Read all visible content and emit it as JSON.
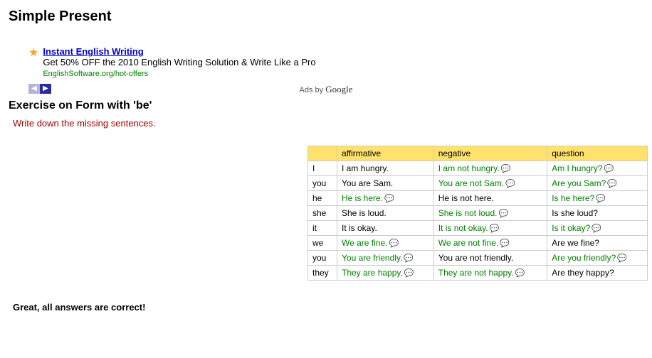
{
  "page_title": "Simple Present",
  "ad": {
    "title": "Instant English Writing",
    "desc": "Get 50% OFF the 2010 English Writing Solution & Write Like a Pro",
    "url": "EnglishSoftware.org/hot-offers",
    "prev_glyph": "◀",
    "next_glyph": "▶",
    "adsby_prefix": "Ads by ",
    "adsby_brand": "Google"
  },
  "exercise_heading": "Exercise on Form with 'be'",
  "instruction": "Write down the missing sentences.",
  "headers": {
    "affirmative": "affirmative",
    "negative": "negative",
    "question": "question"
  },
  "rows": [
    {
      "pron": "I",
      "aff": {
        "text": "I am hungry.",
        "ans": false,
        "note": false
      },
      "neg": {
        "text": "I am not hungry.",
        "ans": true,
        "note": true
      },
      "q": {
        "text": "Am I hungry?",
        "ans": true,
        "note": true
      }
    },
    {
      "pron": "you",
      "aff": {
        "text": "You are Sam.",
        "ans": false,
        "note": false
      },
      "neg": {
        "text": "You are not Sam.",
        "ans": true,
        "note": true
      },
      "q": {
        "text": "Are you Sam?",
        "ans": true,
        "note": true
      }
    },
    {
      "pron": "he",
      "aff": {
        "text": "He is here.",
        "ans": true,
        "note": true
      },
      "neg": {
        "text": "He is not here.",
        "ans": false,
        "note": false
      },
      "q": {
        "text": "Is he here?",
        "ans": true,
        "note": true
      }
    },
    {
      "pron": "she",
      "aff": {
        "text": "She is loud.",
        "ans": false,
        "note": false
      },
      "neg": {
        "text": "She is not loud.",
        "ans": true,
        "note": true
      },
      "q": {
        "text": "Is she loud?",
        "ans": false,
        "note": false
      }
    },
    {
      "pron": "it",
      "aff": {
        "text": "It is okay.",
        "ans": false,
        "note": false
      },
      "neg": {
        "text": "It is not okay.",
        "ans": true,
        "note": true
      },
      "q": {
        "text": "Is it okay?",
        "ans": true,
        "note": true
      }
    },
    {
      "pron": "we",
      "aff": {
        "text": "We are fine.",
        "ans": true,
        "note": true
      },
      "neg": {
        "text": "We are not fine.",
        "ans": true,
        "note": true
      },
      "q": {
        "text": "Are we fine?",
        "ans": false,
        "note": false
      }
    },
    {
      "pron": "you",
      "aff": {
        "text": "You are friendly.",
        "ans": true,
        "note": true
      },
      "neg": {
        "text": "You are not friendly.",
        "ans": false,
        "note": false
      },
      "q": {
        "text": "Are you friendly?",
        "ans": true,
        "note": true
      }
    },
    {
      "pron": "they",
      "aff": {
        "text": "They are happy.",
        "ans": true,
        "note": true
      },
      "neg": {
        "text": "They are not happy.",
        "ans": true,
        "note": true
      },
      "q": {
        "text": "Are they happy?",
        "ans": false,
        "note": false
      }
    }
  ],
  "note_glyph": "💬",
  "result": "Great, all answers are correct!"
}
